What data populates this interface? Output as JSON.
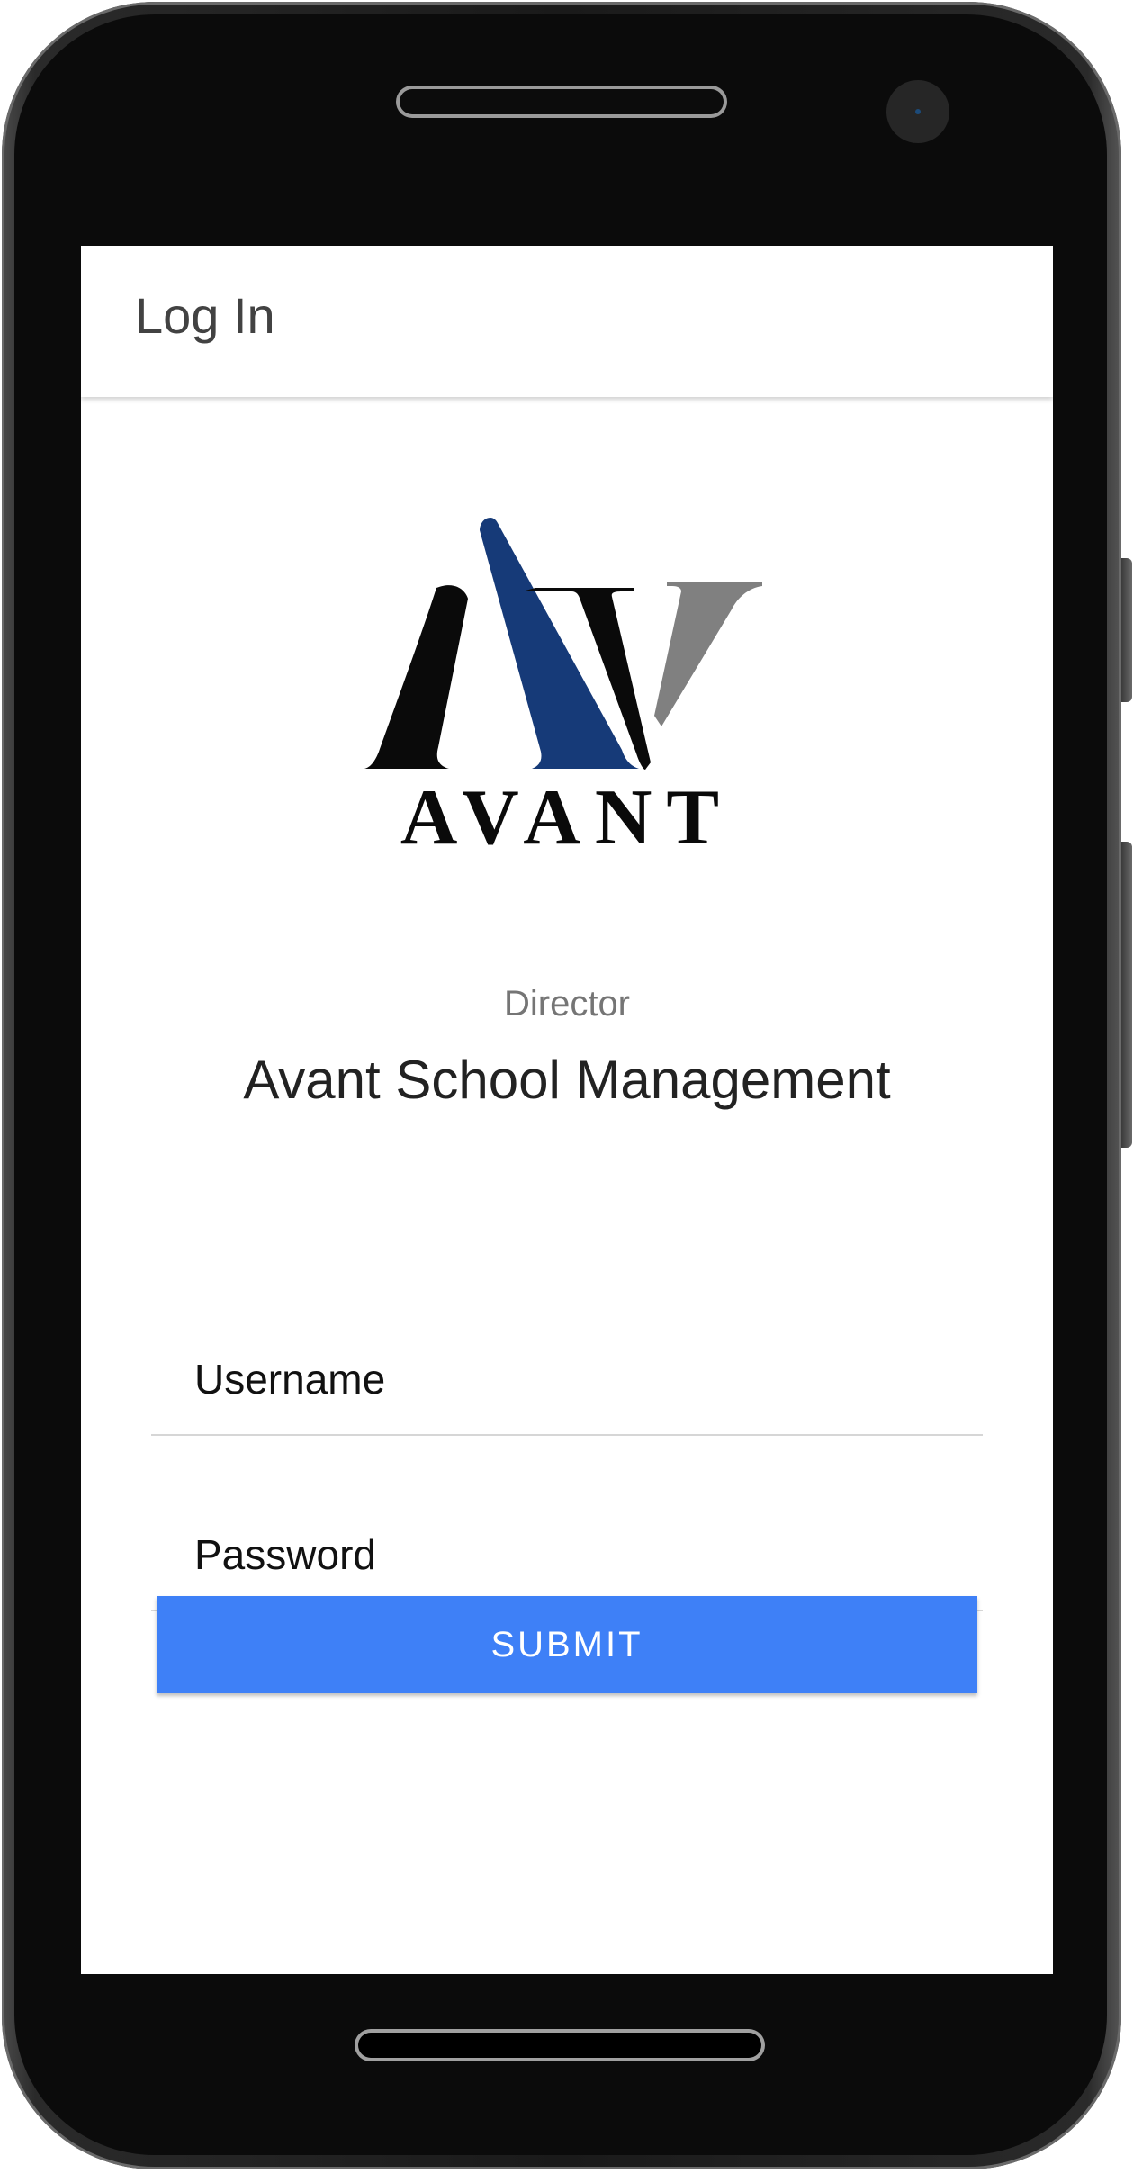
{
  "app_bar": {
    "title": "Log In"
  },
  "logo": {
    "wordmark": "AVANT",
    "colors": {
      "dark": "#0a0a0a",
      "blue": "#163a78",
      "gray": "#808080"
    }
  },
  "header": {
    "role": "Director",
    "app_name": "Avant School Management"
  },
  "form": {
    "username_placeholder": "Username",
    "password_placeholder": "Password",
    "submit_label": "SUBMIT"
  },
  "colors": {
    "accent": "#3e80f7",
    "title_text": "#424242"
  }
}
